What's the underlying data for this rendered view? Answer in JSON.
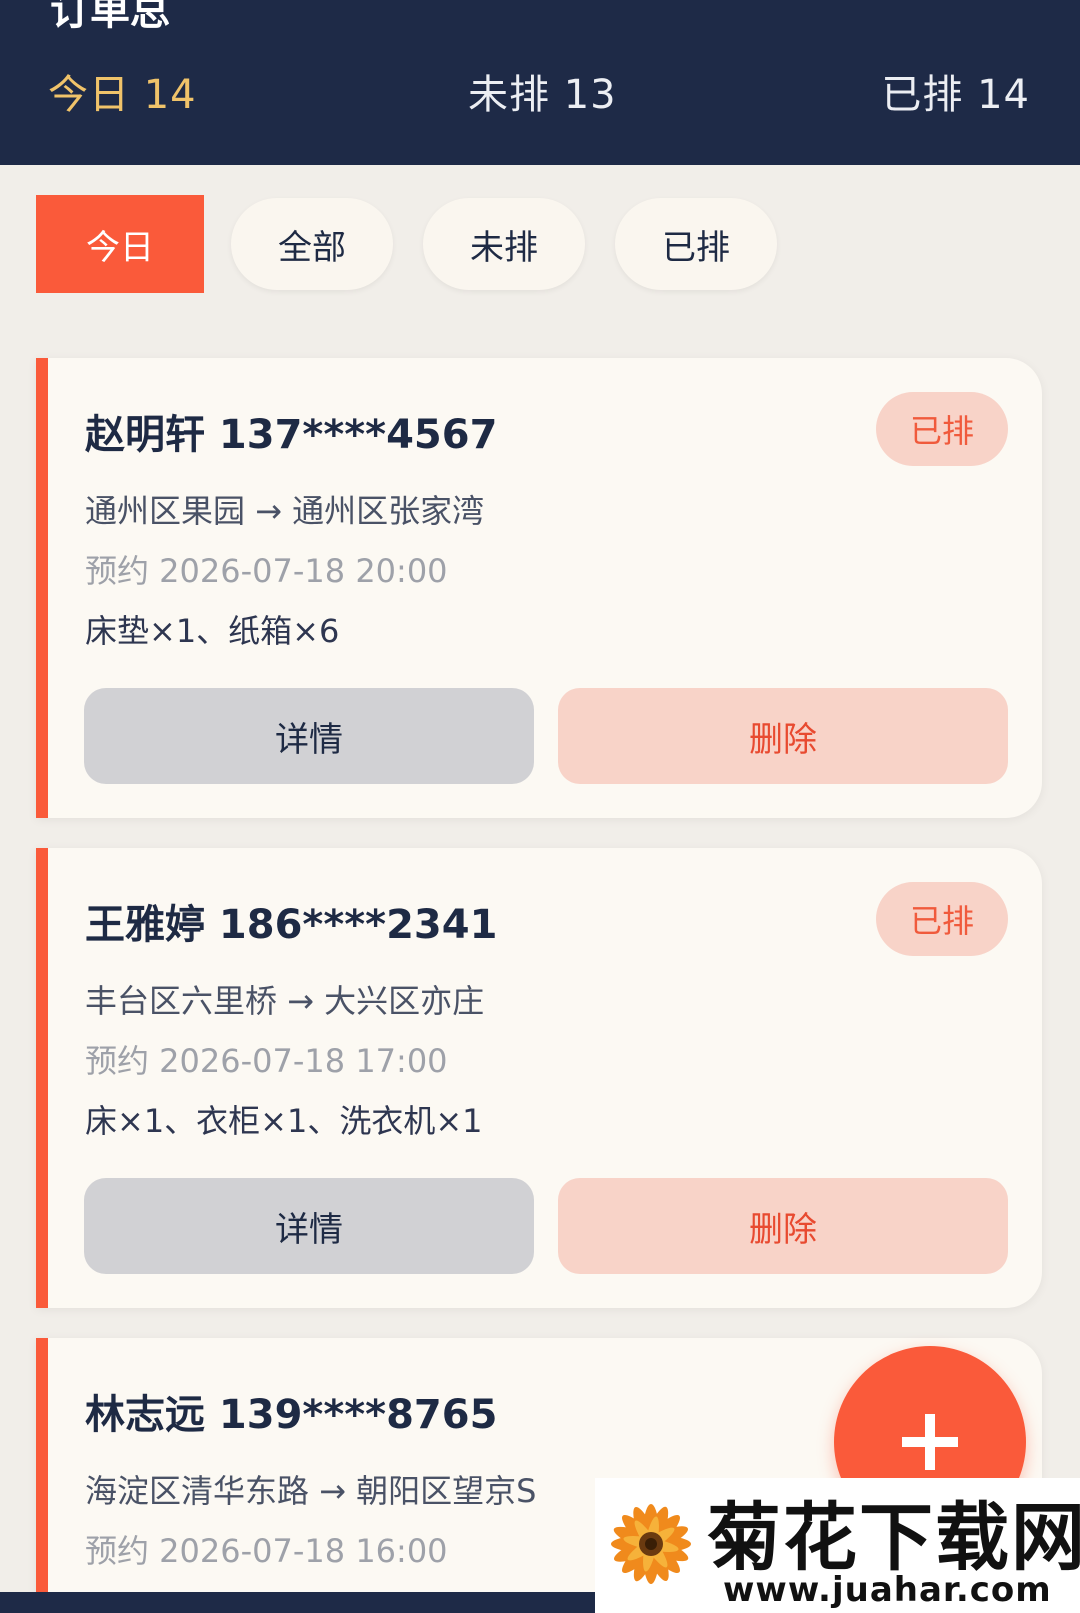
{
  "header": {
    "title": "订单总",
    "stats": [
      {
        "label": "今日 14",
        "active": true
      },
      {
        "label": "未排 13",
        "active": false
      },
      {
        "label": "已排 14",
        "active": false
      }
    ]
  },
  "filters": [
    {
      "label": "今日",
      "active": true
    },
    {
      "label": "全部",
      "active": false
    },
    {
      "label": "未排",
      "active": false
    },
    {
      "label": "已排",
      "active": false
    }
  ],
  "orders": [
    {
      "name_phone": "赵明轩 137****4567",
      "status": "已排",
      "route": "通州区果园 → 通州区张家湾",
      "time": "预约 2026-07-18 20:00",
      "items": "床垫×1、纸箱×6",
      "detail_label": "详情",
      "delete_label": "删除"
    },
    {
      "name_phone": "王雅婷 186****2341",
      "status": "已排",
      "route": "丰台区六里桥 → 大兴区亦庄",
      "time": "预约 2026-07-18 17:00",
      "items": "床×1、衣柜×1、洗衣机×1",
      "detail_label": "详情",
      "delete_label": "删除"
    },
    {
      "name_phone": "林志远 139****8765",
      "route": "海淀区清华东路 → 朝阳区望京S",
      "time": "预约 2026-07-18 16:00"
    }
  ],
  "fab": {
    "icon": "plus-icon"
  },
  "watermark": {
    "name": "菊花下载网",
    "url": "www.juahar.com"
  },
  "colors": {
    "header_bg": "#1e2a47",
    "accent": "#fa5a3a",
    "active_stat": "#f0c36a",
    "badge_bg": "#f8d3c8",
    "page_bg": "#f1eee9"
  }
}
